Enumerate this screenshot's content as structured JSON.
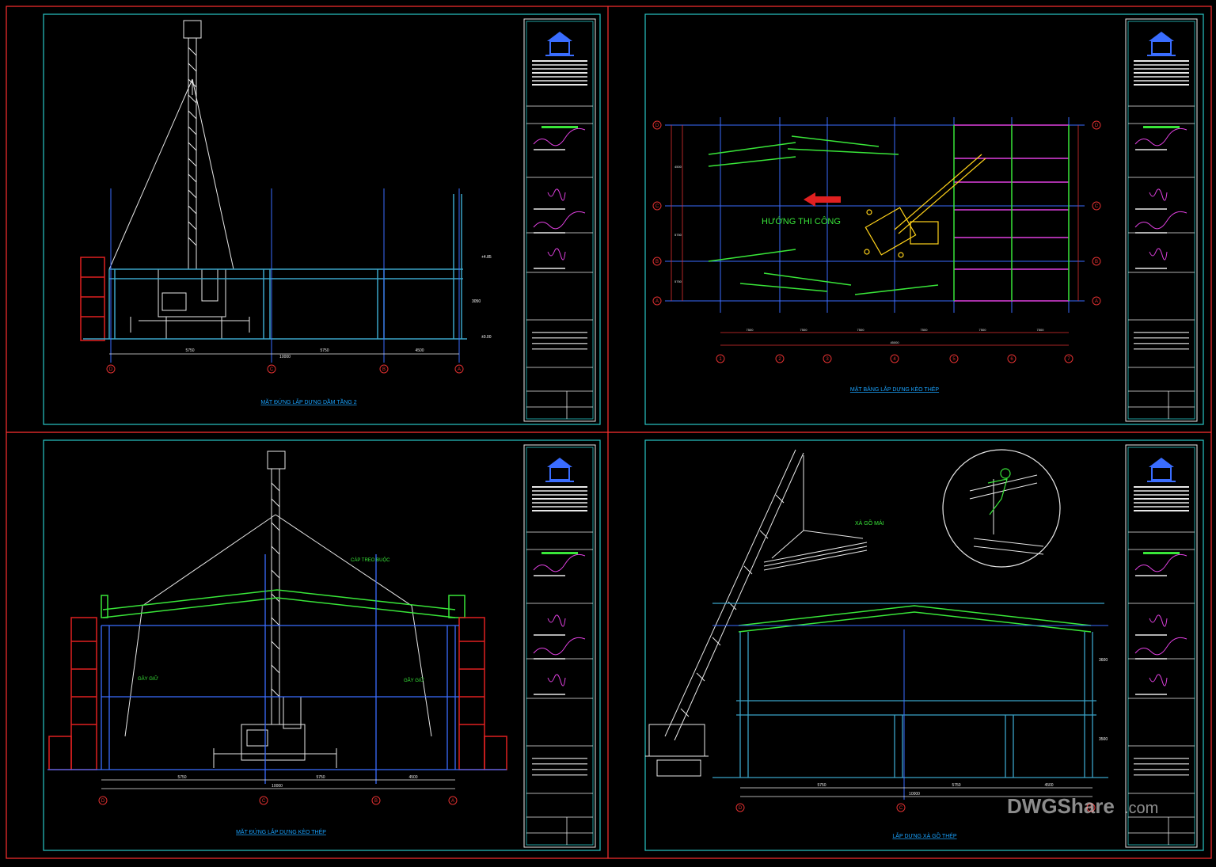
{
  "colors": {
    "background": "#000000",
    "sheet_border": "#ff3030",
    "frame": "#29c6c6",
    "structure": "#3a6dff",
    "steel": "#3aa4c8",
    "truss": "#39e639",
    "scaffold": "#e02020",
    "crane": "#e8e8e8",
    "excavator": "#ffd21a",
    "magenta": "#e040e0",
    "dim": "#e03030",
    "label_green": "#39e639",
    "title_blue": "#1aa3ff",
    "watermark": "#ffffff"
  },
  "sheets": [
    {
      "title": "MẶT ĐỨNG LẮP DỰNG DẦM TẦNG 2",
      "grid_labels": [
        "D",
        "C",
        "B",
        "A"
      ],
      "dims": [
        "5750",
        "10000",
        "5750",
        "4500"
      ],
      "levels": [
        "+4.85",
        "±0.00"
      ],
      "height_dim": "3050",
      "sheet_no": "BT - 39"
    },
    {
      "title": "MẶT BẰNG LẮP DỰNG KÈO THÉP",
      "direction_label": "HƯỚNG THI CÔNG",
      "row_labels": [
        "D",
        "C",
        "B",
        "A"
      ],
      "col_labels": [
        "1",
        "2",
        "3",
        "4",
        "5",
        "6",
        "7"
      ],
      "dims": [
        "7500",
        "7500",
        "7500",
        "7500",
        "7500",
        "7500"
      ],
      "total_dim": "45000",
      "side_dims": [
        "4500",
        "5750",
        "5750"
      ],
      "sheet_no": "BT - 34"
    },
    {
      "title": "MẶT ĐỨNG LẮP DỰNG KÈO THÉP",
      "labels": [
        "CÁP TREO BUỘC",
        "GÂY GIỮ",
        "GÂY GIỮ"
      ],
      "grid_labels": [
        "D",
        "C",
        "B",
        "A"
      ],
      "dims": [
        "5750",
        "5750",
        "4500"
      ],
      "total_dim": "10000",
      "sheet_no": "BT - 37"
    },
    {
      "title": "LẮP DỰNG XÀ GỒ THÉP",
      "labels": [
        "XÀ GỒ MÁI"
      ],
      "grid_labels": [
        "D",
        "C",
        "A"
      ],
      "dims": [
        "5750",
        "5750",
        "4500"
      ],
      "total_dim": "10000",
      "heights": [
        "3600",
        "3500"
      ],
      "sheet_no": "BT - 38"
    }
  ],
  "title_block": {
    "logo_icon": "pagoda-logo-icon",
    "signature_icon": "signature-icon",
    "scale": "TỶ LỆ: 1/100"
  },
  "watermark": {
    "brand": "DWGShare",
    "domain": ".com"
  }
}
